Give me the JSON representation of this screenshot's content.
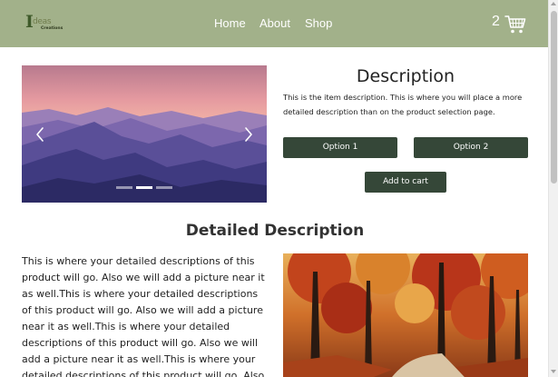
{
  "header": {
    "logo": {
      "initial": "I",
      "name": "deas",
      "tagline": "Creations"
    },
    "nav": [
      {
        "label": "Home"
      },
      {
        "label": "About"
      },
      {
        "label": "Shop"
      }
    ],
    "cart_count": "2",
    "cart_icon": "shopping-cart-icon"
  },
  "product": {
    "description_title": "Description",
    "description_text": "This is the item description. This is where you will place a more detailed description than on the product selection page.",
    "option1_label": "Option 1",
    "option2_label": "Option 2",
    "add_to_cart_label": "Add to cart"
  },
  "carousel": {
    "prev_icon": "chevron-left-icon",
    "next_icon": "chevron-right-icon",
    "slide_count": 3,
    "active_index": 1
  },
  "detailed": {
    "title": "Detailed Description",
    "text": "This is where your detailed descriptions of this product will go. Also we will add a picture near it as well.This is where your detailed descriptions of this product will go. Also we will add a picture near it as well.This is where your detailed descriptions of this product will go. Also we will add a picture near it as well.This is where your detailed descriptions of this product will go. Also we will add a picture near it as well."
  },
  "colors": {
    "header_bg": "#a2b18a",
    "button_bg": "#354738",
    "text": "#222222"
  }
}
